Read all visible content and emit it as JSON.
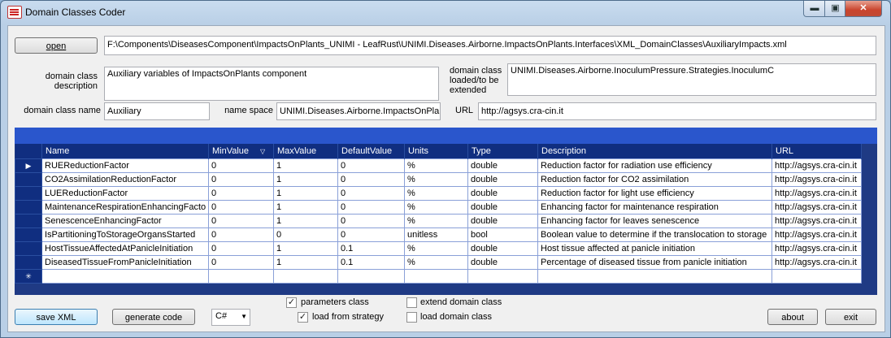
{
  "window": {
    "title": "Domain Classes Coder",
    "min_glyph": "▬",
    "max_glyph": "▣",
    "close_glyph": "✕"
  },
  "open_button": "open",
  "file_path": "F:\\Components\\DiseasesComponent\\ImpactsOnPlants_UNIMI - LeafRust\\UNIMI.Diseases.Airborne.ImpactsOnPlants.Interfaces\\XML_DomainClasses\\AuxiliaryImpacts.xml",
  "description": {
    "label": "domain class description",
    "value": "Auxiliary variables of ImpactsOnPlants component"
  },
  "extended": {
    "label": "domain class loaded/to be extended",
    "value": "UNIMI.Diseases.Airborne.InoculumPressure.Strategies.InoculumC"
  },
  "class_name": {
    "label": "domain class name",
    "value": "Auxiliary"
  },
  "namespace": {
    "label": "name space",
    "value": "UNIMI.Diseases.Airborne.ImpactsOnPlant"
  },
  "url_field": {
    "label": "URL",
    "value": "http://agsys.cra-cin.it"
  },
  "grid": {
    "columns": [
      "Name",
      "MinValue",
      "MaxValue",
      "DefaultValue",
      "Units",
      "Type",
      "Description",
      "URL"
    ],
    "sort_glyph": "▽",
    "current_row_glyph": "▶",
    "new_row_glyph": "✳",
    "rows": [
      [
        "RUEReductionFactor",
        "0",
        "1",
        "0",
        "%",
        "double",
        "Reduction factor for radiation use efficiency",
        "http://agsys.cra-cin.it"
      ],
      [
        "CO2AssimilationReductionFactor",
        "0",
        "1",
        "0",
        "%",
        "double",
        "Reduction factor for CO2 assimilation",
        "http://agsys.cra-cin.it"
      ],
      [
        "LUEReductionFactor",
        "0",
        "1",
        "0",
        "%",
        "double",
        "Reduction factor for light use efficiency",
        "http://agsys.cra-cin.it"
      ],
      [
        "MaintenanceRespirationEnhancingFacto",
        "0",
        "1",
        "0",
        "%",
        "double",
        "Enhancing  factor for maintenance respiration",
        "http://agsys.cra-cin.it"
      ],
      [
        "SenescenceEnhancingFactor",
        "0",
        "1",
        "0",
        "%",
        "double",
        "Enhancing factor for leaves senescence",
        "http://agsys.cra-cin.it"
      ],
      [
        "IsPartitioningToStorageOrgansStarted",
        "0",
        "0",
        "0",
        "unitless",
        "bool",
        "Boolean value to determine if the translocation to storage",
        "http://agsys.cra-cin.it"
      ],
      [
        "HostTissueAffectedAtPanicleInitiation",
        "0",
        "1",
        "0.1",
        "%",
        "double",
        "Host tissue affected at panicle initiation",
        "http://agsys.cra-cin.it"
      ],
      [
        "DiseasedTissueFromPanicleInitiation",
        "0",
        "1",
        "0.1",
        "%",
        "double",
        "Percentage of diseased tissue from panicle initiation",
        "http://agsys.cra-cin.it"
      ]
    ]
  },
  "checkboxes": {
    "parameters_class": {
      "label": "parameters class",
      "checked": true,
      "mark": "✓"
    },
    "load_from_strategy": {
      "label": "load from strategy",
      "checked": true,
      "mark": "✓"
    },
    "extend_domain_class": {
      "label": "extend domain class",
      "checked": false
    },
    "load_domain_class": {
      "label": "load domain class",
      "checked": false
    }
  },
  "buttons": {
    "save_xml": "save XML",
    "generate_code": "generate code",
    "about": "about",
    "exit": "exit"
  },
  "language_select": {
    "value": "C#",
    "arrow": "▼"
  }
}
